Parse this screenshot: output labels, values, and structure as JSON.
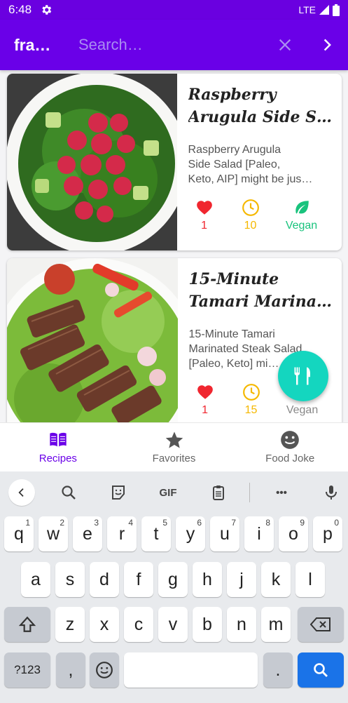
{
  "status_bar": {
    "time": "6:48",
    "network": "LTE",
    "icons": [
      "gear-icon",
      "signal-icon",
      "battery-icon"
    ]
  },
  "toolbar": {
    "title": "fra…",
    "search_placeholder": "Search…",
    "icons": [
      "close-icon",
      "chevron-right-icon"
    ]
  },
  "recipes": [
    {
      "title_line1": "Raspberry",
      "title_line2": "Arugula Side S…",
      "desc_line1": "Raspberry Arugula",
      "desc_line2": "Side Salad [Paleo,",
      "desc_line3": "Keto, AIP] might be jus…",
      "likes": "1",
      "minutes": "10",
      "diet": "Vegan"
    },
    {
      "title_line1": "15-Minute",
      "title_line2": "Tamari Marina…",
      "desc_line1": "15-Minute Tamari",
      "desc_line2": "Marinated Steak Salad",
      "desc_line3": "[Paleo, Keto] mi…",
      "likes": "1",
      "minutes": "15",
      "diet": "Vegan"
    }
  ],
  "fab": {
    "icon": "cutlery-icon"
  },
  "bottom_nav": [
    {
      "label": "Recipes",
      "icon": "book-icon",
      "active": true
    },
    {
      "label": "Favorites",
      "icon": "star-icon",
      "active": false
    },
    {
      "label": "Food Joke",
      "icon": "smiley-icon",
      "active": false
    }
  ],
  "keyboard": {
    "toolbar": {
      "gif_label": "GIF",
      "more_label": "•••"
    },
    "row1": [
      {
        "k": "q",
        "h": "1"
      },
      {
        "k": "w",
        "h": "2"
      },
      {
        "k": "e",
        "h": "3"
      },
      {
        "k": "r",
        "h": "4"
      },
      {
        "k": "t",
        "h": "5"
      },
      {
        "k": "y",
        "h": "6"
      },
      {
        "k": "u",
        "h": "7"
      },
      {
        "k": "i",
        "h": "8"
      },
      {
        "k": "o",
        "h": "9"
      },
      {
        "k": "p",
        "h": "0"
      }
    ],
    "row2": [
      "a",
      "s",
      "d",
      "f",
      "g",
      "h",
      "j",
      "k",
      "l"
    ],
    "row3": [
      "z",
      "x",
      "c",
      "v",
      "b",
      "n",
      "m"
    ],
    "symbols_label": "?123",
    "comma": ",",
    "period": "."
  },
  "colors": {
    "primary": "#6a00e8",
    "accent": "#14d6bf",
    "heart": "#f0262f",
    "clock": "#f5b800",
    "vegan": "#19c37d"
  }
}
